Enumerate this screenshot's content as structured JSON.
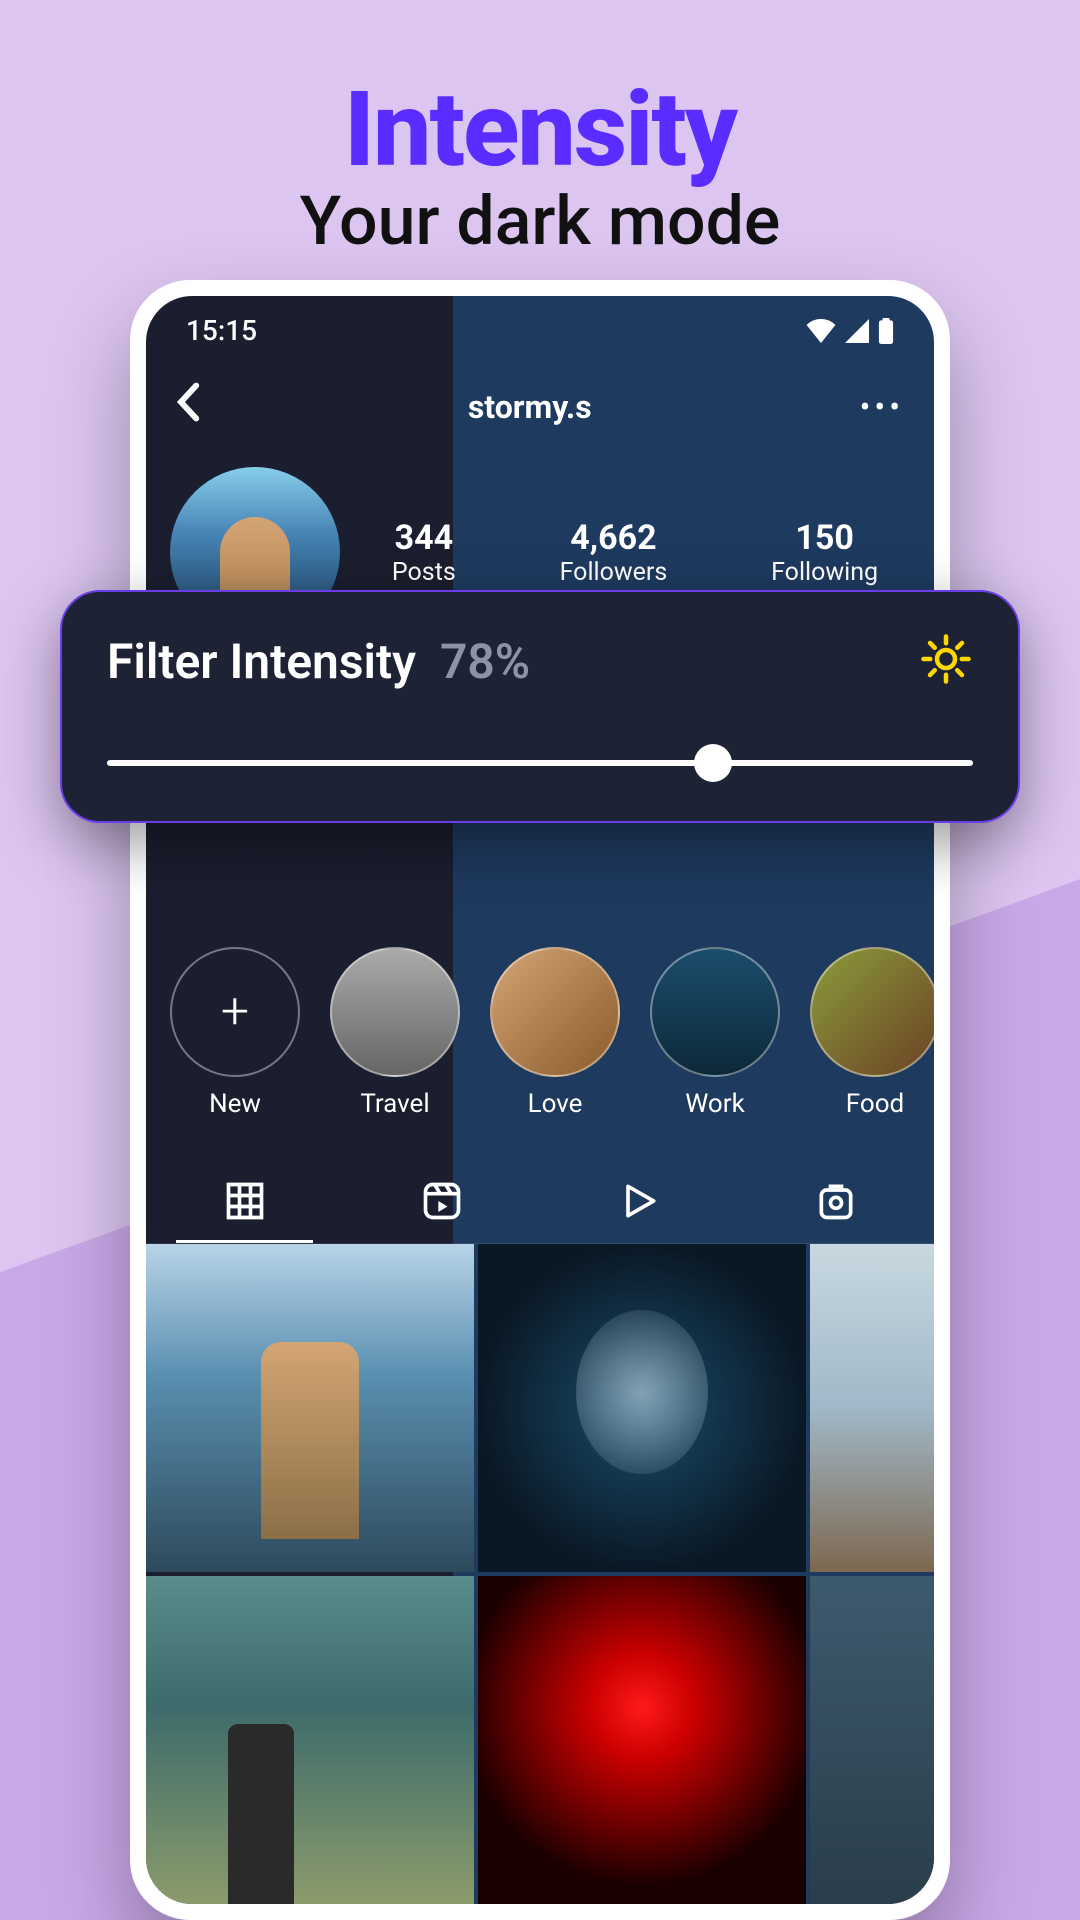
{
  "promo": {
    "title": "Intensity",
    "subtitle": "Your dark mode"
  },
  "statusBar": {
    "time": "15:15"
  },
  "nav": {
    "username": "stormy.s"
  },
  "profile": {
    "stats": [
      {
        "value": "344",
        "label": "Posts"
      },
      {
        "value": "4,662",
        "label": "Followers"
      },
      {
        "value": "150",
        "label": "Following"
      }
    ]
  },
  "highlights": [
    {
      "label": "New"
    },
    {
      "label": "Travel"
    },
    {
      "label": "Love"
    },
    {
      "label": "Work"
    },
    {
      "label": "Food"
    }
  ],
  "overlay": {
    "title": "Filter Intensity",
    "value": "78%",
    "sliderPercent": 70
  }
}
